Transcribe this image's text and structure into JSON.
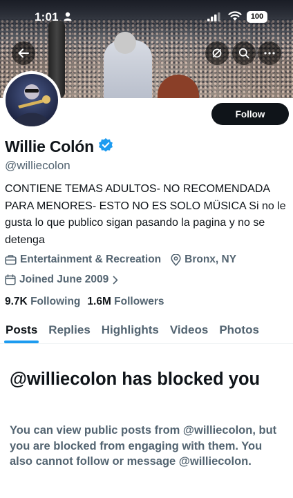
{
  "status_bar": {
    "time": "1:01",
    "battery": "100",
    "icons": [
      "person-icon",
      "signal-icon",
      "wifi-icon",
      "battery-icon"
    ]
  },
  "header_buttons": [
    "back-arrow-icon",
    "grok-icon",
    "search-icon",
    "more-icon"
  ],
  "profile": {
    "display_name": "Willie Colón",
    "handle": "@williecolon",
    "follow_label": "Follow",
    "bio": "CONTIENE TEMAS ADULTOS- NO RECOMENDADA PARA MENORES- ESTO NO ES SOLO MÜSICA Si no le gusta lo que publico sigan pasando la pagina y no se detenga",
    "category": "Entertainment & Recreation",
    "location": "Bronx, NY",
    "joined": "Joined June 2009",
    "following_count": "9.7K",
    "following_label": "Following",
    "followers_count": "1.6M",
    "followers_label": "Followers"
  },
  "tabs": [
    {
      "label": "Posts",
      "active": true
    },
    {
      "label": "Replies",
      "active": false
    },
    {
      "label": "Highlights",
      "active": false
    },
    {
      "label": "Videos",
      "active": false
    },
    {
      "label": "Photos",
      "active": false
    }
  ],
  "blocked": {
    "title": "@williecolon has blocked you",
    "body": "You can view public posts from @williecolon, but you are blocked from engaging with them. You also cannot follow or message @williecolon."
  },
  "colors": {
    "accent": "#1d9bf0",
    "text_primary": "#0f1419",
    "text_secondary": "#536471",
    "button_dark": "#0f1419"
  }
}
